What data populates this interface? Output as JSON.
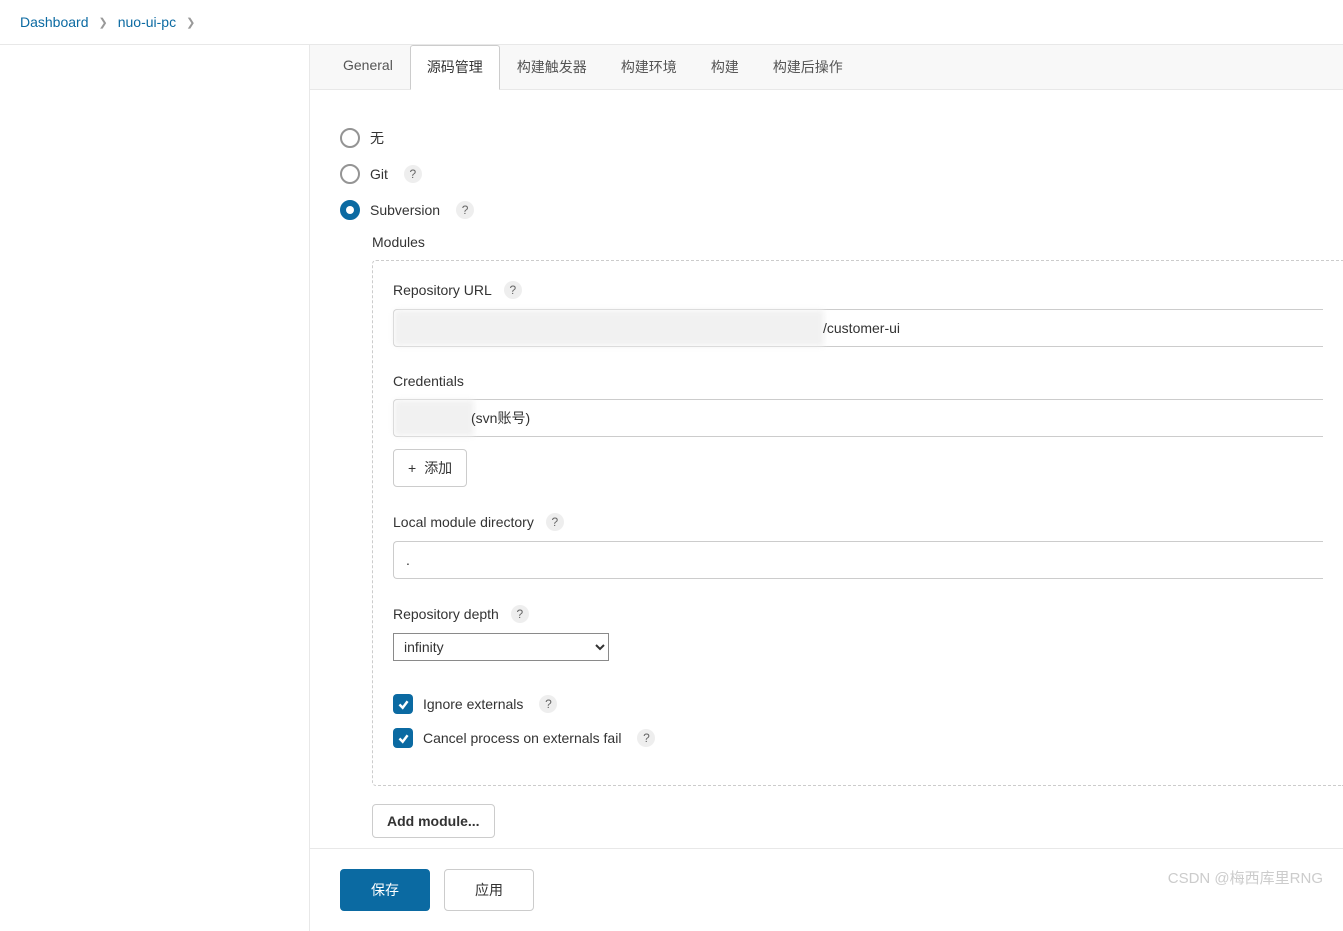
{
  "breadcrumb": {
    "items": [
      "Dashboard",
      "nuo-ui-pc"
    ]
  },
  "tabs": {
    "general": "General",
    "scm": "源码管理",
    "triggers": "构建触发器",
    "env": "构建环境",
    "build": "构建",
    "post": "构建后操作"
  },
  "scm": {
    "none": "无",
    "git": "Git",
    "subversion": "Subversion",
    "modules_label": "Modules",
    "repo_url_label": "Repository URL",
    "repo_url_value": "/customer-ui",
    "credentials_label": "Credentials",
    "credentials_value": "(svn账号)",
    "add_label": "添加",
    "local_dir_label": "Local module directory",
    "local_dir_value": ".",
    "depth_label": "Repository depth",
    "depth_value": "infinity",
    "ignore_externals": "Ignore externals",
    "cancel_on_fail": "Cancel process on externals fail",
    "add_module": "Add module..."
  },
  "footer": {
    "save": "保存",
    "apply": "应用"
  },
  "watermark": "CSDN @梅西库里RNG"
}
